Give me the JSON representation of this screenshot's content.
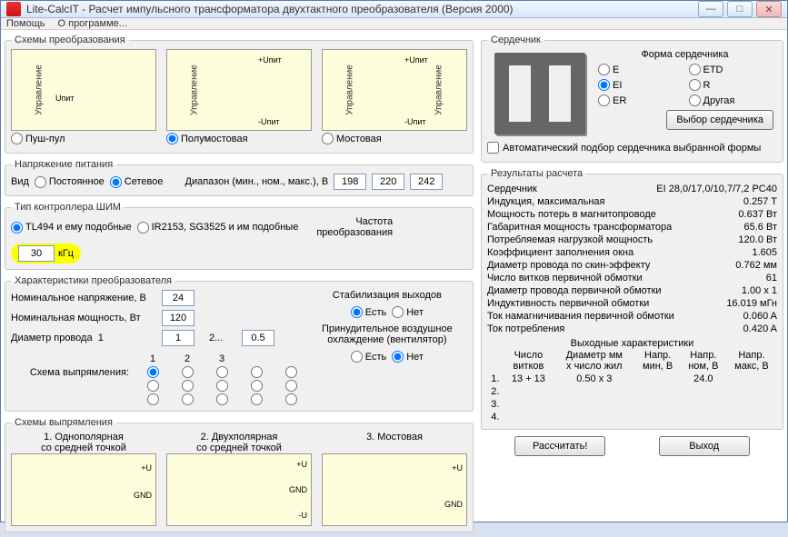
{
  "window": {
    "title": "Lite-CalcIT - Расчет импульсного трансформатора двухтактного преобразователя (Версия 2000)",
    "min": "—",
    "max": "□",
    "close": "✕"
  },
  "menu": {
    "help": "Помощь",
    "about": "О программе..."
  },
  "schemes": {
    "legend": "Схемы преобразования",
    "pushpull": "Пуш-пул",
    "halfbridge": "Полумостовая",
    "bridge": "Мостовая",
    "ctrl": "Управление",
    "upit": "Uпит",
    "upitp": "+Uпит",
    "upitm": "-Uпит"
  },
  "supply": {
    "legend": "Напряжение питания",
    "kind": "Вид",
    "dc": "Постоянное",
    "ac": "Сетевое",
    "range": "Диапазон (мин., ном., макс.), В",
    "v1": "198",
    "v2": "220",
    "v3": "242"
  },
  "pwm": {
    "legend": "Тип контроллера ШИМ",
    "tl494": "TL494 и ему подобные",
    "ir2153": "IR2153, SG3525 и им подобные",
    "freqlbl1": "Частота",
    "freqlbl2": "преобразования",
    "freq": "30",
    "unit": "кГц"
  },
  "chars": {
    "legend": "Характеристики преобразователя",
    "nv": "Номинальное напряжение, В",
    "nvval": "24",
    "np": "Номинальная мощность, Вт",
    "npval": "120",
    "wd": "Диаметр провода",
    "wd1": "1",
    "wd1v": "1",
    "wd2": "2...",
    "wd2v": "0.5",
    "rect": "Схема выпрямления:",
    "r1": "1",
    "r2": "2",
    "r3": "3",
    "stab": "Стабилизация выходов",
    "yes": "Есть",
    "no": "Нет",
    "cool1": "Принудительное воздушное",
    "cool2": "охлаждение (вентилятор)"
  },
  "rectschemes": {
    "legend": "Схемы выпрямления",
    "s1a": "1. Однополярная",
    "s1b": "со средней точкой",
    "s2a": "2. Двухполярная",
    "s2b": "со средней точкой",
    "s3": "3. Мостовая",
    "u": "+U",
    "gnd": "GND",
    "mu": "-U"
  },
  "core": {
    "legend": "Сердечник",
    "shape": "Форма сердечника",
    "e": "E",
    "etd": "ETD",
    "ei": "EI",
    "r": "R",
    "er": "ER",
    "other": "Другая",
    "pick": "Выбор сердечника",
    "auto": "Автоматический подбор сердечника выбранной формы"
  },
  "res": {
    "legend": "Результаты расчета",
    "l1": "Сердечник",
    "v1": "EI 28,0/17,0/10,7/7,2 PC40",
    "l2": "Индукция, максимальная",
    "v2": "0.257 T",
    "l3": "Мощность потерь в магнитопроводе",
    "v3": "0.637 Вт",
    "l4": "Габаритная мощность трансформатора",
    "v4": "65.6 Вт",
    "l5": "Потребляемая нагрузкой мощность",
    "v5": "120.0 Вт",
    "l6": "Коэффициент заполнения окна",
    "v6": "1.605",
    "l7": "Диаметр провода по скин-эффекту",
    "v7": "0.762 мм",
    "l8": "Число витков первичной обмотки",
    "v8": "61",
    "l9": "Диаметр провода первичной обмотки",
    "v9": "1.00 x 1",
    "l10": "Индуктивность первичной обмотки",
    "v10": "16.019 мГн",
    "l11": "Ток намагничивания первичной обмотки",
    "v11": "0.060 A",
    "l12": "Ток потребления",
    "v12": "0.420 A",
    "outhdr": "Выходные характеристики",
    "h1": "Число",
    "h1b": "витков",
    "h2": "Диаметр мм",
    "h2b": "x число жил",
    "h3": "Напр.",
    "h3b": "мин, В",
    "h4": "Напр.",
    "h4b": "ном, В",
    "h5": "Напр.",
    "h5b": "макс, В",
    "r1": "1.",
    "r1a": "13 + 13",
    "r1b": "0.50 x 3",
    "r1d": "24.0",
    "r2": "2.",
    "r3": "3.",
    "r4": "4."
  },
  "actions": {
    "calc": "Рассчитать!",
    "exit": "Выход"
  }
}
